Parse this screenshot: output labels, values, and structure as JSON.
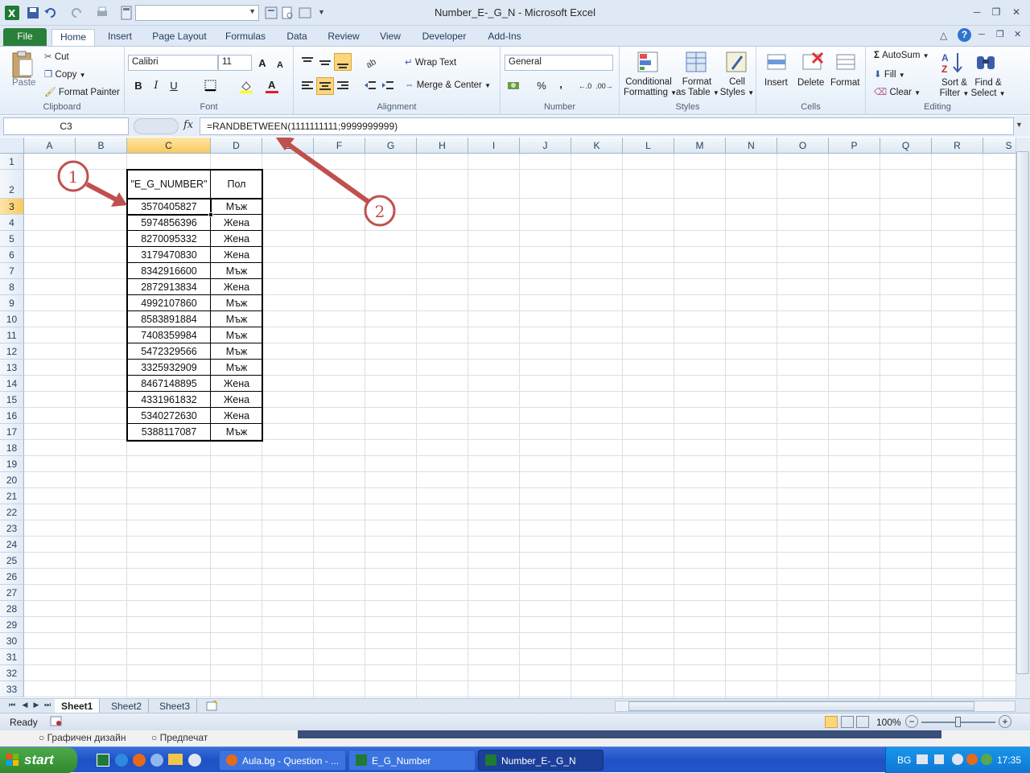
{
  "window": {
    "title": "Number_E-_G_N  -  Microsoft Excel"
  },
  "title_buttons": {
    "minimize": "─",
    "restore": "❐",
    "close": "✕"
  },
  "tabs": [
    "File",
    "Home",
    "Insert",
    "Page Layout",
    "Formulas",
    "Data",
    "Review",
    "View",
    "Developer",
    "Add-Ins"
  ],
  "ribbon": {
    "clipboard": {
      "label": "Clipboard",
      "paste": "Paste",
      "cut": "Cut",
      "copy": "Copy",
      "format_painter": "Format Painter"
    },
    "font": {
      "label": "Font",
      "name": "Calibri",
      "size": "11",
      "bold": "B",
      "italic": "I",
      "underline": "U",
      "grow": "A",
      "shrink": "A"
    },
    "alignment": {
      "label": "Alignment",
      "wrap": "Wrap Text",
      "merge": "Merge & Center"
    },
    "number": {
      "label": "Number",
      "format": "General",
      "percent": "%",
      "comma": ","
    },
    "styles": {
      "label": "Styles",
      "conditional_1": "Conditional",
      "conditional_2": "Formatting",
      "table_1": "Format",
      "table_2": "as Table",
      "cell_1": "Cell",
      "cell_2": "Styles"
    },
    "cells": {
      "label": "Cells",
      "insert": "Insert",
      "delete": "Delete",
      "format": "Format"
    },
    "editing": {
      "label": "Editing",
      "autosum": "AutoSum",
      "fill": "Fill",
      "clear": "Clear",
      "sort_1": "Sort &",
      "sort_2": "Filter",
      "find_1": "Find &",
      "find_2": "Select"
    }
  },
  "formula_bar": {
    "namebox": "C3",
    "fx": "fx",
    "formula": "=RANDBETWEEN(1111111111;9999999999)"
  },
  "columns": [
    "A",
    "B",
    "C",
    "D",
    "E",
    "F",
    "G",
    "H",
    "I",
    "J",
    "K",
    "L",
    "M",
    "N",
    "O",
    "P",
    "Q",
    "R",
    "S"
  ],
  "rows": [
    "1",
    "2",
    "3",
    "4",
    "5",
    "6",
    "7",
    "8",
    "9",
    "10",
    "11",
    "12",
    "13",
    "14",
    "15",
    "16",
    "17",
    "18",
    "19",
    "20",
    "21",
    "22",
    "23",
    "24",
    "25",
    "26",
    "27",
    "28",
    "29",
    "30",
    "31",
    "32",
    "33"
  ],
  "table": {
    "header_c": "\"E_G_NUMBER\"",
    "header_d": "Пол",
    "rows": [
      [
        "3570405827",
        "Мъж"
      ],
      [
        "5974856396",
        "Жена"
      ],
      [
        "8270095332",
        "Жена"
      ],
      [
        "3179470830",
        "Жена"
      ],
      [
        "8342916600",
        "Мъж"
      ],
      [
        "2872913834",
        "Жена"
      ],
      [
        "4992107860",
        "Мъж"
      ],
      [
        "8583891884",
        "Мъж"
      ],
      [
        "7408359984",
        "Мъж"
      ],
      [
        "5472329566",
        "Мъж"
      ],
      [
        "3325932909",
        "Мъж"
      ],
      [
        "8467148895",
        "Жена"
      ],
      [
        "4331961832",
        "Жена"
      ],
      [
        "5340272630",
        "Жена"
      ],
      [
        "5388117087",
        "Мъж"
      ]
    ]
  },
  "annotations": {
    "one": "1",
    "two": "2",
    "color": "#c0504d"
  },
  "sheets": [
    "Sheet1",
    "Sheet2",
    "Sheet3"
  ],
  "status": {
    "ready": "Ready",
    "zoom": "100%"
  },
  "behind_window": {
    "opt1": "Графичен дизайн",
    "opt2": "Предпечат"
  },
  "taskbar": {
    "start": "start",
    "tasks": [
      "Aula.bg - Question - ...",
      "E_G_Number",
      "Number_E-_G_N"
    ],
    "lang": "BG",
    "clock": "17:35"
  }
}
